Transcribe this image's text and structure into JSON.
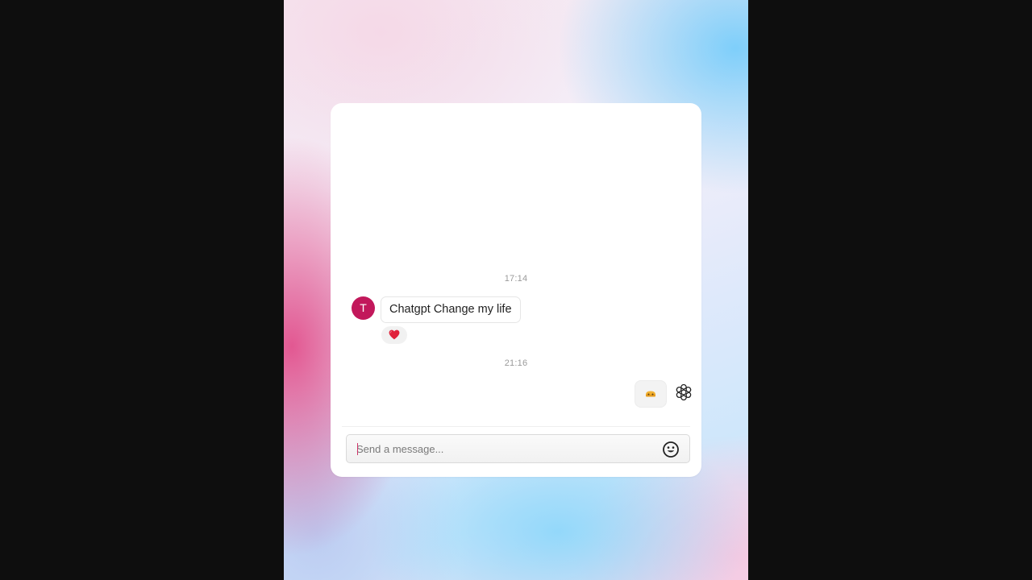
{
  "conversation": {
    "timestamps": [
      "17:14",
      "21:16"
    ],
    "incoming": {
      "avatar_initial": "T",
      "avatar_color": "#c2185b",
      "message": "Chatgpt Change my life",
      "reaction_icon": "red-heart-icon"
    },
    "outgoing": {
      "content_icon": "yellow-emoji-icon",
      "sender_icon": "openai-logo-icon"
    }
  },
  "composer": {
    "placeholder": "Send a message...",
    "value": "",
    "emoji_icon": "emoji-smiley-icon"
  },
  "colors": {
    "accent": "#c2185b",
    "outer_background": "#0e0e0e",
    "card_background": "#ffffff"
  }
}
